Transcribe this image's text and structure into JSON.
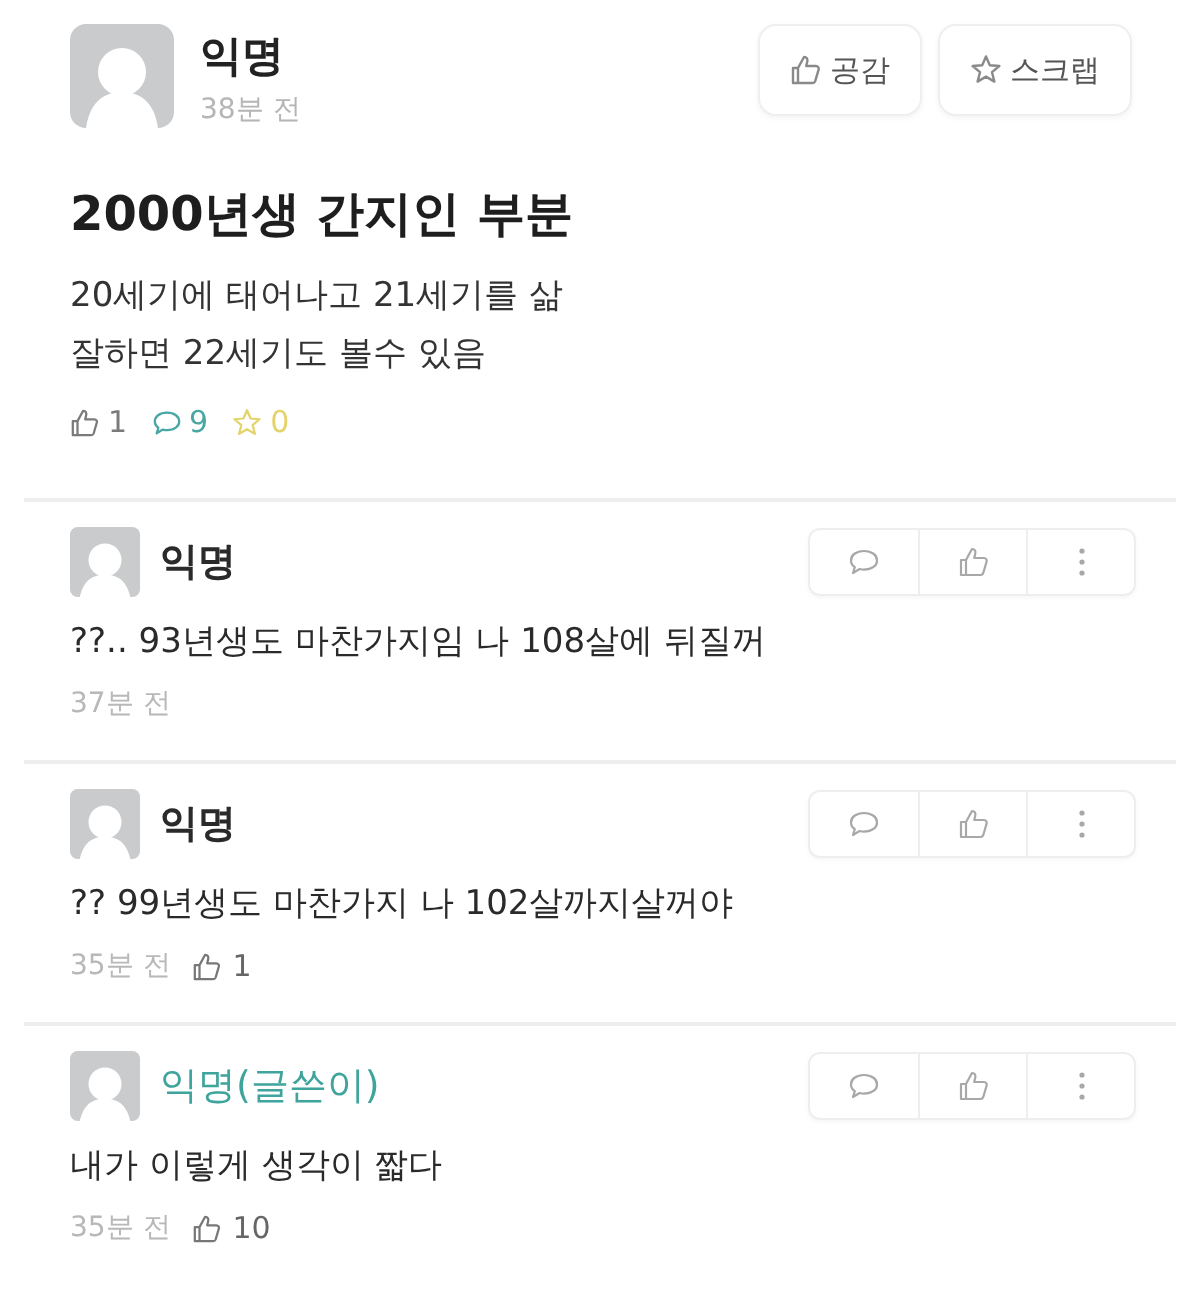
{
  "post": {
    "author": "익명",
    "time": "38분 전",
    "actions": [
      {
        "kind": "like",
        "label": "공감"
      },
      {
        "kind": "scrap",
        "label": "스크랩"
      }
    ],
    "title": "2000년생 간지인 부분",
    "body": "20세기에 태어나고 21세기를 삶\n잘하면 22세기도 볼수 있음",
    "stats": [
      {
        "kind": "like",
        "count": "1"
      },
      {
        "kind": "comment",
        "count": "9"
      },
      {
        "kind": "scrap",
        "count": "0"
      }
    ]
  },
  "comments": [
    {
      "author": "익명",
      "is_writer": false,
      "text": "??.. 93년생도 마찬가지임 나 108살에 뒤질꺼",
      "time": "37분 전"
    },
    {
      "author": "익명",
      "is_writer": false,
      "text": "?? 99년생도 마찬가지 나 102살까지살꺼야",
      "time": "35분 전",
      "likes": "1"
    },
    {
      "author": "익명(글쓴이)",
      "is_writer": true,
      "text": "내가 이렇게 생각이 짧다",
      "time": "35분 전",
      "likes": "10"
    }
  ]
}
